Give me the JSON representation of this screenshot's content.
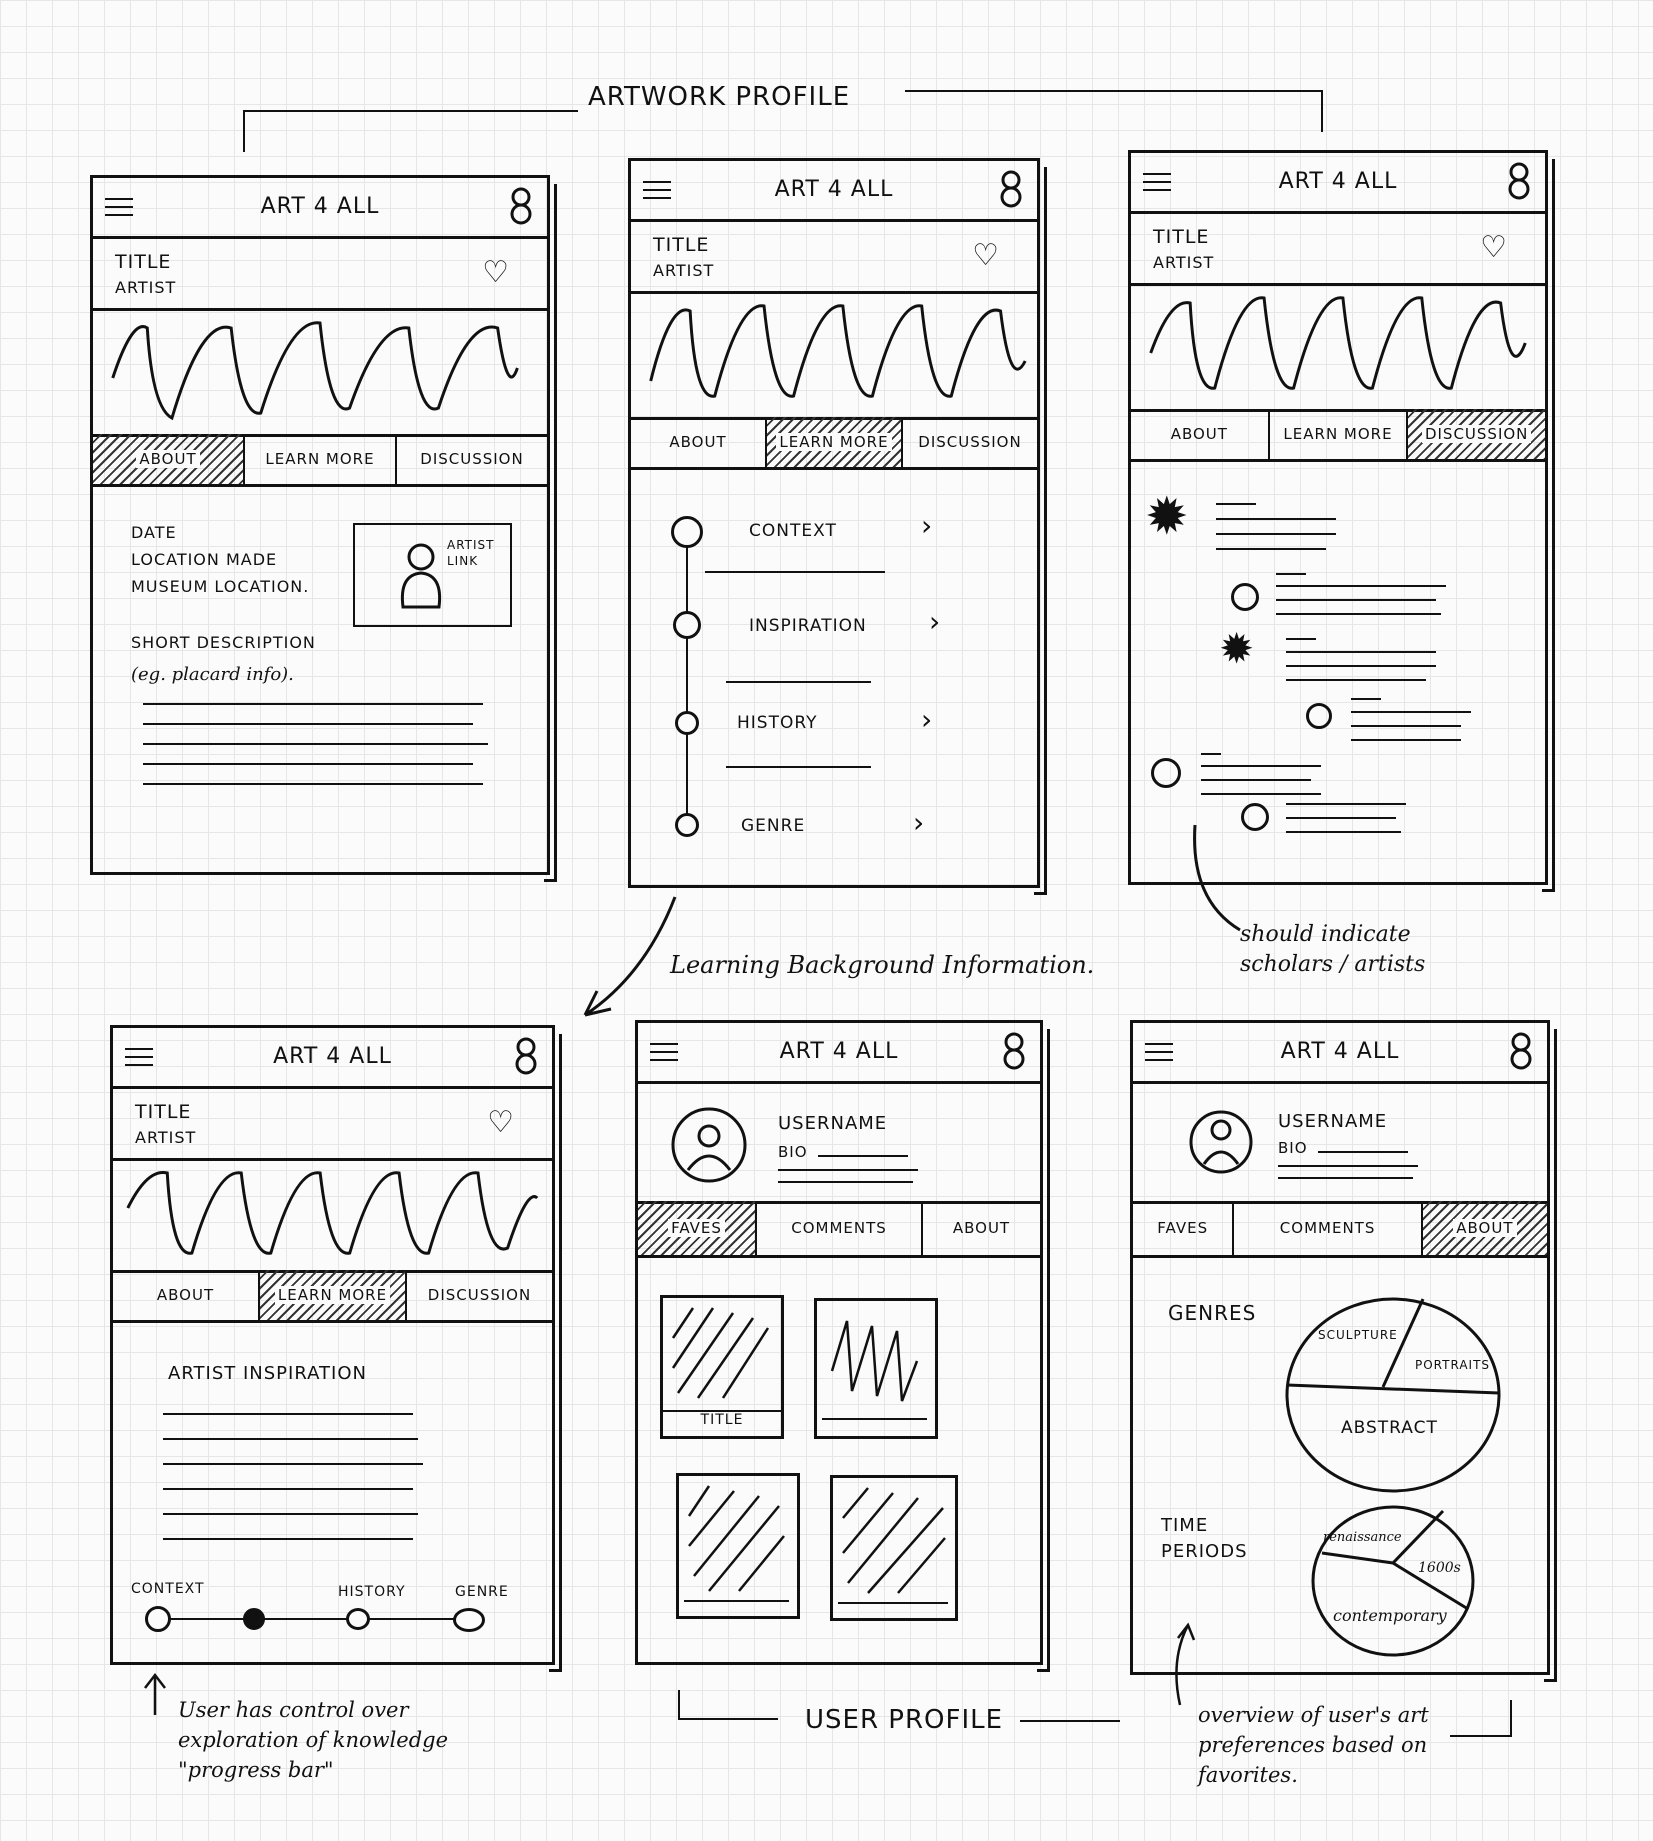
{
  "section_titles": {
    "artwork_profile": "ARTWORK PROFILE",
    "user_profile": "USER PROFILE"
  },
  "app_title": "ART 4 ALL",
  "artwork": {
    "title": "TITLE",
    "artist": "ARTIST",
    "tabs": [
      "ABOUT",
      "LEARN MORE",
      "DISCUSSION"
    ]
  },
  "about_panel": {
    "lines": [
      "DATE",
      "LOCATION MADE",
      "MUSEUM LOCATION."
    ],
    "artist_link": "ARTIST LINK",
    "short_description": "SHORT DESCRIPTION",
    "short_description_note": "(eg. placard info)."
  },
  "learn_more_panel": {
    "items": [
      "CONTEXT",
      "INSPIRATION",
      "HISTORY",
      "GENRE"
    ]
  },
  "annotations": {
    "learning": "Learning Background Information.",
    "discussion": "should indicate scholars / artists",
    "progress": "User has control over exploration of knowledge \"progress bar\"",
    "preferences": "overview of user's art preferences based on favorites."
  },
  "learn_detail_panel": {
    "heading": "ARTIST INSPIRATION",
    "progress_labels": [
      "CONTEXT",
      "HISTORY",
      "GENRE"
    ]
  },
  "user_profile": {
    "username": "USERNAME",
    "bio": "BIO",
    "tabs": [
      "FAVES",
      "COMMENTS",
      "ABOUT"
    ],
    "fave_title": "TITLE"
  },
  "preferences": {
    "genres_label": "GENRES",
    "genres": [
      "SCULPTURE",
      "PORTRAITS",
      "ABSTRACT"
    ],
    "time_periods_label": "TIME PERIODS",
    "time_periods": [
      "renaissance",
      "1600s",
      "contemporary"
    ]
  }
}
